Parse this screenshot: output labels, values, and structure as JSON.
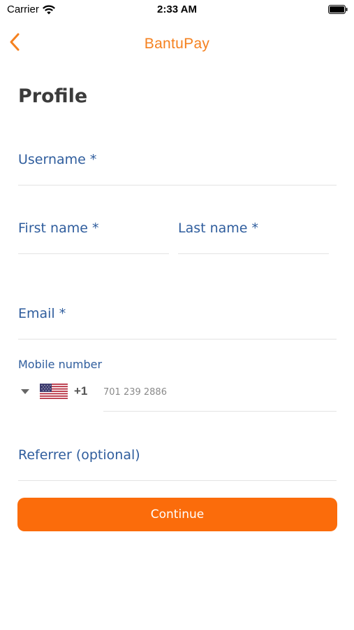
{
  "status_bar": {
    "carrier": "Carrier",
    "time": "2:33 AM",
    "wifi_icon": "wifi-icon",
    "battery_icon": "battery-full-icon"
  },
  "nav": {
    "back_icon": "chevron-left-icon",
    "brand": "BantuPay"
  },
  "page": {
    "title": "Profile"
  },
  "form": {
    "username_label": "Username *",
    "first_name_label": "First name *",
    "last_name_label": "Last name *",
    "email_label": "Email *",
    "mobile_label": "Mobile number",
    "country_flag_icon": "us-flag-icon",
    "dial_code": "+1",
    "phone_placeholder": "701 239 2886",
    "referrer_label": "Referrer (optional)",
    "continue_label": "Continue"
  },
  "colors": {
    "accent": "#f5811f",
    "button": "#fb6c0b",
    "label": "#2f5d9d",
    "divider": "#e3e3e3"
  }
}
